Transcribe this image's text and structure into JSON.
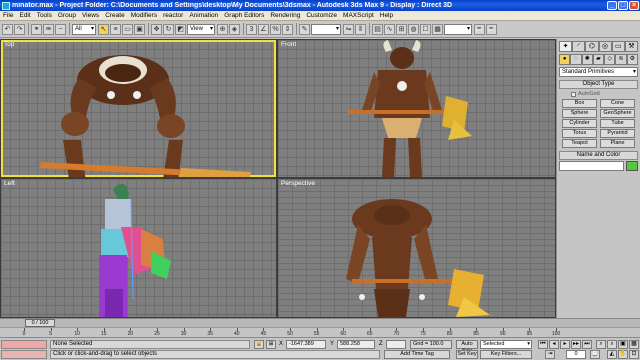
{
  "window": {
    "title": "minator.max - Project Folder: C:\\Documents and Settings\\desktop\\My Documents\\3dsmax - Autodesk 3ds Max 9 - Display : Direct 3D",
    "minimize": "_",
    "maximize": "□",
    "close": "×"
  },
  "menu": [
    "File",
    "Edit",
    "Tools",
    "Group",
    "Views",
    "Create",
    "Modifiers",
    "reactor",
    "Animation",
    "Graph Editors",
    "Rendering",
    "Customize",
    "MAXScript",
    "Help"
  ],
  "toolbar": {
    "selection_filter": "All",
    "reference_coord": "View",
    "named_selection": ""
  },
  "viewports": [
    {
      "label": "Top",
      "active": true
    },
    {
      "label": "Front",
      "active": false
    },
    {
      "label": "Left",
      "active": false
    },
    {
      "label": "Perspective",
      "active": false
    }
  ],
  "command_panel": {
    "category_dropdown": "Standard Primitives",
    "object_type_title": "Object Type",
    "autogrid_label": "AutoGrid",
    "object_buttons": [
      "Box",
      "Cone",
      "Sphere",
      "GeoSphere",
      "Cylinder",
      "Tube",
      "Torus",
      "Pyramid",
      "Teapot",
      "Plane"
    ],
    "name_color_title": "Name and Color",
    "object_color": "#55c840"
  },
  "timeline": {
    "frame_indicator": "0 / 100",
    "ticks": [
      "0",
      "5",
      "10",
      "15",
      "20",
      "25",
      "30",
      "35",
      "40",
      "45",
      "50",
      "55",
      "60",
      "65",
      "70",
      "75",
      "80",
      "85",
      "90",
      "95",
      "100"
    ]
  },
  "status": {
    "selection": "None Selected",
    "prompt": "Click or click-and-drag to select objects",
    "x_label": "X",
    "x_value": "-1647.389",
    "y_label": "Y",
    "y_value": "588.258",
    "z_label": "Z",
    "z_value": "",
    "grid": "Grid = 100.0",
    "auto_key": "Auto Key",
    "set_key": "Set Key",
    "key_mode": "Selected",
    "key_filters": "Key Filters...",
    "add_time_tag": "Add Time Tag",
    "current_frame": "0"
  }
}
